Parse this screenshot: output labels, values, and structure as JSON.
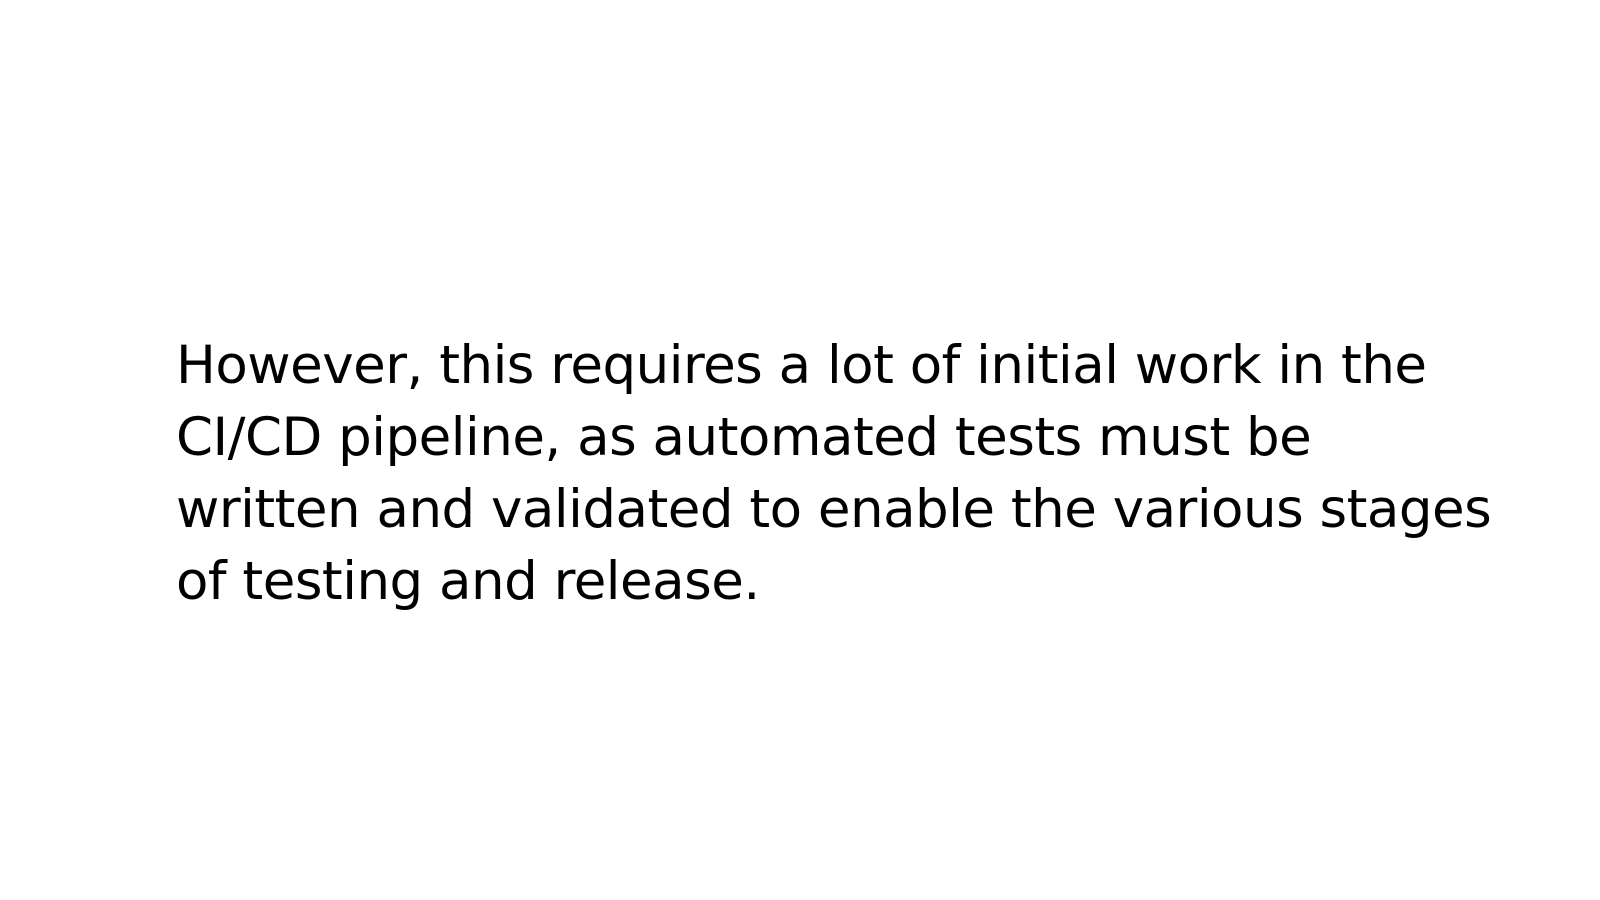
{
  "slide": {
    "lines": [
      "However, this requires a lot of initial work in the",
      "CI/CD pipeline, as automated tests must be",
      "written and validated to enable the various stages",
      "of testing and release."
    ]
  }
}
